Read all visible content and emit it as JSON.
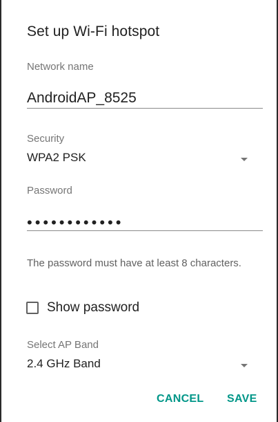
{
  "dialog": {
    "title": "Set up Wi-Fi hotspot",
    "network_name": {
      "label": "Network name",
      "value": "AndroidAP_8525"
    },
    "security": {
      "label": "Security",
      "selected": "WPA2 PSK"
    },
    "password": {
      "label": "Password",
      "masked_value": "••••••••••••",
      "hint": "The password must have at least 8 characters."
    },
    "show_password": {
      "label": "Show password",
      "checked": false
    },
    "ap_band": {
      "label": "Select AP Band",
      "selected": "2.4 GHz Band"
    },
    "buttons": {
      "cancel": "CANCEL",
      "save": "SAVE"
    }
  },
  "colors": {
    "accent": "#009688",
    "text_primary": "#212121",
    "text_secondary": "#757575"
  }
}
